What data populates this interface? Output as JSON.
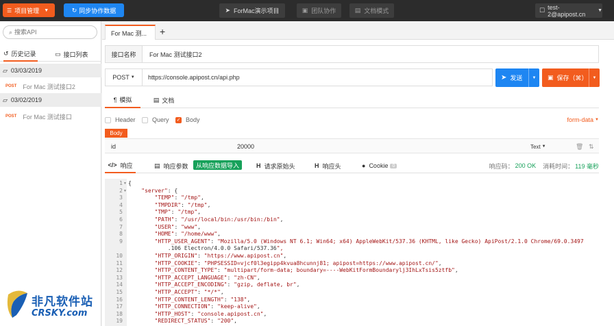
{
  "topbar": {
    "project_btn": "项目管理",
    "sync_btn": "同步协作数据",
    "app_title": "ForMac演示项目",
    "team_btn": "团队协作",
    "doc_mode_btn": "文档模式",
    "user": "test-2@apipost.cn"
  },
  "sidebar": {
    "search_placeholder": "搜索API",
    "tabs": [
      {
        "label": "历史记录"
      },
      {
        "label": "接口列表"
      }
    ],
    "groups": [
      {
        "date": "03/03/2019",
        "items": [
          {
            "method": "POST",
            "name": "For Mac 测试接口2"
          }
        ]
      },
      {
        "date": "03/02/2019",
        "items": [
          {
            "method": "POST",
            "name": "For Mac 测试接口"
          }
        ]
      }
    ]
  },
  "request_tab": {
    "label": "For Mac 测..."
  },
  "request": {
    "name_label": "接口名称",
    "name_value": "For Mac 测试接口2",
    "method": "POST",
    "url": "https://console.apipost.cn/api.php",
    "send_btn": "发送",
    "save_btn": "保存（⌘）"
  },
  "mode_tabs": [
    {
      "label": "模拟"
    },
    {
      "label": "文档"
    }
  ],
  "options": {
    "header": "Header",
    "query": "Query",
    "body": "Body",
    "body_type": "form-data"
  },
  "body_badge": "Body",
  "params": [
    {
      "key": "id",
      "value": "20000",
      "type": "Text"
    }
  ],
  "response_tabs": {
    "response": "响应",
    "response_params": "响应参数",
    "import_btn": "从响应数据导入",
    "raw_headers": "请求原始头",
    "resp_headers": "响应头",
    "cookie": "Cookie",
    "cookie_count": "0"
  },
  "response_meta": {
    "code_label": "响应码：",
    "code_value": "200 OK",
    "time_label": "消耗时间：",
    "time_value": "119 毫秒"
  },
  "code_lines": [
    {
      "n": "1",
      "text": "{",
      "fold": true
    },
    {
      "n": "2",
      "text": "    \"server\": {",
      "fold": true
    },
    {
      "n": "3",
      "text": "        \"TEMP\": \"/tmp\","
    },
    {
      "n": "4",
      "text": "        \"TMPDIR\": \"/tmp\","
    },
    {
      "n": "5",
      "text": "        \"TMP\": \"/tmp\","
    },
    {
      "n": "6",
      "text": "        \"PATH\": \"/usr/local/bin:/usr/bin:/bin\","
    },
    {
      "n": "7",
      "text": "        \"USER\": \"www\","
    },
    {
      "n": "8",
      "text": "        \"HOME\": \"/home/www\","
    },
    {
      "n": "9",
      "text": "        \"HTTP_USER_AGENT\": \"Mozilla/5.0 (Windows NT 6.1; Win64; x64) AppleWebKit/537.36 (KHTML, like Gecko) ApiPost/2.1.0 Chrome/69.0.3497"
    },
    {
      "n": "",
      "text": "            .106 Electron/4.0.0 Safari/537.36\","
    },
    {
      "n": "10",
      "text": "        \"HTTP_ORIGIN\": \"https://www.apipost.cn\","
    },
    {
      "n": "11",
      "text": "        \"HTTP_COOKIE\": \"PHPSESSID=vjcf0l3egipp4kvua8hcunnj81; apipost=https://www.apipost.cn/\","
    },
    {
      "n": "12",
      "text": "        \"HTTP_CONTENT_TYPE\": \"multipart/form-data; boundary=----WebKitFormBoundarylj3IhLxTsis5ztfb\","
    },
    {
      "n": "13",
      "text": "        \"HTTP_ACCEPT_LANGUAGE\": \"zh-CN\","
    },
    {
      "n": "14",
      "text": "        \"HTTP_ACCEPT_ENCODING\": \"gzip, deflate, br\","
    },
    {
      "n": "15",
      "text": "        \"HTTP_ACCEPT\": \"*/*\","
    },
    {
      "n": "16",
      "text": "        \"HTTP_CONTENT_LENGTH\": \"138\","
    },
    {
      "n": "17",
      "text": "        \"HTTP_CONNECTION\": \"keep-alive\","
    },
    {
      "n": "18",
      "text": "        \"HTTP_HOST\": \"console.apipost.cn\","
    },
    {
      "n": "19",
      "text": "        \"REDIRECT_STATUS\": \"200\","
    }
  ],
  "watermark": {
    "title": "非凡软件站",
    "sub": "CRSKY.com"
  },
  "colors": {
    "accent": "#f25c1e",
    "primary": "#1e86f2",
    "success": "#17a15a"
  }
}
